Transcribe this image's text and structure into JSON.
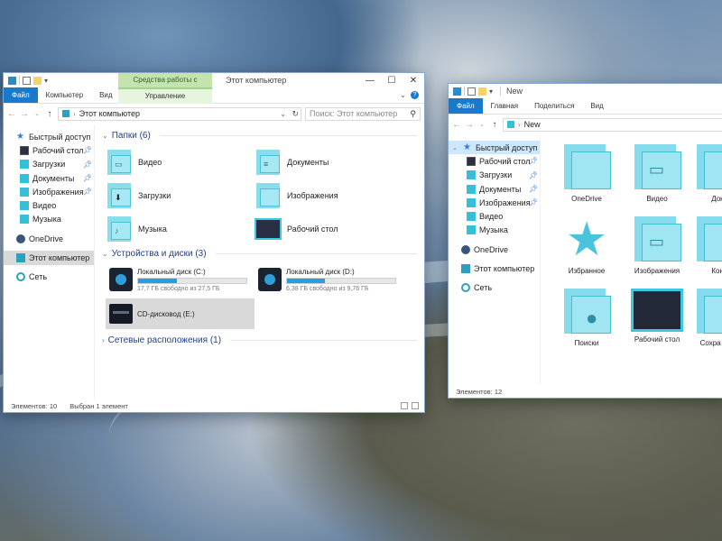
{
  "window1": {
    "tool_tab": "Средства работы с дисками",
    "title": "Этот компьютер",
    "ribbon": {
      "file": "Файл",
      "computer": "Компьютер",
      "view": "Вид",
      "manage": "Управление"
    },
    "address": "Этот компьютер",
    "search_placeholder": "Поиск: Этот компьютер",
    "nav": {
      "quick_access": "Быстрый доступ",
      "desktop": "Рабочий стол",
      "downloads": "Загрузки",
      "documents": "Документы",
      "pictures": "Изображения",
      "video": "Видео",
      "music": "Музыка",
      "onedrive": "OneDrive",
      "this_pc": "Этот компьютер",
      "network": "Сеть"
    },
    "folders_header": "Папки (6)",
    "folders": [
      "Видео",
      "Документы",
      "Загрузки",
      "Изображения",
      "Музыка",
      "Рабочий стол"
    ],
    "devices_header": "Устройства и диски (3)",
    "drives": [
      {
        "name": "Локальный диск (C:)",
        "info": "17,7 ГБ свободно из 27,5 ГБ",
        "used_fraction": 0.36
      },
      {
        "name": "Локальный диск (D:)",
        "info": "6,38 ГБ свободно из 9,76 ГБ",
        "used_fraction": 0.35
      },
      {
        "name": "CD-дисковод (E:)"
      }
    ],
    "network_header": "Сетевые расположения (1)",
    "status_items": "Элементов: 10",
    "status_selected": "Выбран 1 элемент"
  },
  "window2": {
    "title": "New",
    "ribbon": {
      "file": "Файл",
      "home": "Главная",
      "share": "Поделиться",
      "view": "Вид"
    },
    "address": "New",
    "nav": {
      "quick_access": "Быстрый доступ",
      "desktop": "Рабочий стол",
      "downloads": "Загрузки",
      "documents": "Документы",
      "pictures": "Изображения",
      "video": "Видео",
      "music": "Музыка",
      "onedrive": "OneDrive",
      "this_pc": "Этот компьютер",
      "network": "Сеть"
    },
    "items": [
      "OneDrive",
      "Видео",
      "Доку",
      "Избранное",
      "Изображения",
      "Конт",
      "Поиски",
      "Рабочий стол",
      "Сохра игры"
    ],
    "status_items": "Элементов: 12"
  },
  "colors": {
    "accent": "#1979ca",
    "tool_tab": "#c3e5ad",
    "folder": "#5ccfe4",
    "drive_bar": "#26a0da"
  }
}
